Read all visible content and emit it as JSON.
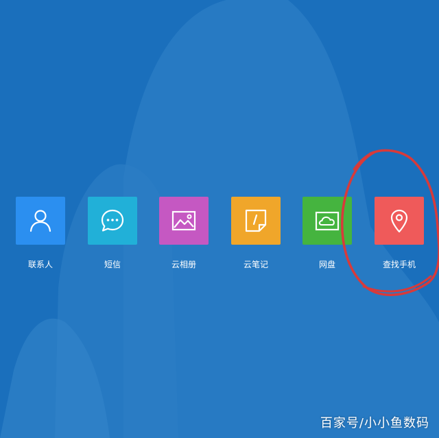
{
  "apps": [
    {
      "label": "联系人",
      "color": "#2b8ff0",
      "icon": "person-icon"
    },
    {
      "label": "短信",
      "color": "#21b0d8",
      "icon": "chat-bubble-icon"
    },
    {
      "label": "云相册",
      "color": "#c558c2",
      "icon": "image-icon"
    },
    {
      "label": "云笔记",
      "color": "#f0a62a",
      "icon": "note-icon"
    },
    {
      "label": "网盘",
      "color": "#45b43f",
      "icon": "cloud-drive-icon"
    },
    {
      "label": "查找手机",
      "color": "#ef5a5a",
      "icon": "location-pin-icon"
    }
  ],
  "watermark": "百家号/小小鱼数码",
  "colors": {
    "background": "#1a6fbc",
    "mountain": "#2a7cc4",
    "annotation": "#d83a3a"
  }
}
